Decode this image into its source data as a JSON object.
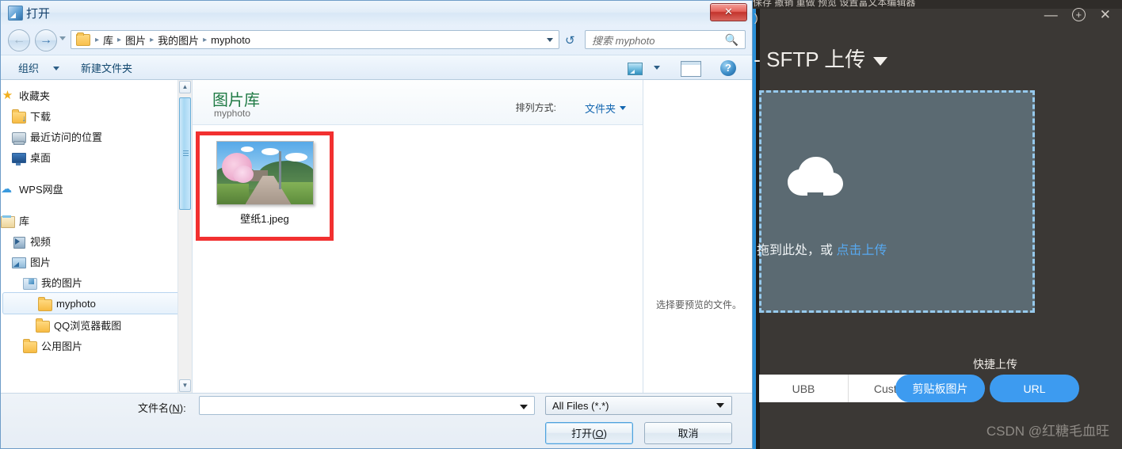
{
  "dialog": {
    "title": "打开",
    "title_icon": "picture-app-icon",
    "close_label": "✕",
    "nav": {
      "back_icon": "arrow-left-icon",
      "forward_icon": "arrow-right-icon",
      "history_icon": "chevron-down-icon",
      "folder_icon": "folder-icon",
      "breadcrumbs": [
        "库",
        "图片",
        "我的图片",
        "myphoto"
      ],
      "separator": "▸",
      "address_caret_icon": "chevron-down-icon",
      "refresh_icon": "refresh-icon"
    },
    "search": {
      "placeholder": "搜索 myphoto",
      "icon": "search-icon"
    },
    "toolbar": {
      "organize": "组织",
      "organize_caret_icon": "chevron-down-icon",
      "new_folder": "新建文件夹",
      "view_icon": "view-mode-icon",
      "view_caret_icon": "chevron-down-icon",
      "preview_pane_icon": "preview-pane-icon",
      "help_icon": "?"
    },
    "sidebar": {
      "items": [
        {
          "label": "收藏夹",
          "icon": "star-icon",
          "indent": 0,
          "selected": false
        },
        {
          "label": "下载",
          "icon": "download-folder-icon",
          "indent": 1,
          "selected": false
        },
        {
          "label": "最近访问的位置",
          "icon": "recent-places-icon",
          "indent": 1,
          "selected": false
        },
        {
          "label": "桌面",
          "icon": "desktop-icon",
          "indent": 1,
          "selected": false
        },
        {
          "label": "WPS网盘",
          "icon": "cloud-icon",
          "indent": 0,
          "selected": false
        },
        {
          "label": "库",
          "icon": "library-icon",
          "indent": 0,
          "selected": false
        },
        {
          "label": "视频",
          "icon": "video-library-icon",
          "indent": 1,
          "selected": false
        },
        {
          "label": "图片",
          "icon": "pictures-library-icon",
          "indent": 1,
          "selected": false
        },
        {
          "label": "我的图片",
          "icon": "my-pictures-icon",
          "indent": 2,
          "selected": false
        },
        {
          "label": "myphoto",
          "icon": "folder-icon",
          "indent": 3,
          "selected": true
        },
        {
          "label": "QQ浏览器截图",
          "icon": "folder-icon",
          "indent": 3,
          "selected": false
        },
        {
          "label": "公用图片",
          "icon": "folder-icon",
          "indent": 2,
          "selected": false
        }
      ],
      "scrollbar": {
        "up_arrow_icon": "▲",
        "down_arrow_icon": "▼"
      }
    },
    "library": {
      "title": "图片库",
      "subtitle": "myphoto",
      "arrange_label": "排列方式:",
      "arrange_value": "文件夹",
      "arrange_caret_icon": "chevron-down-icon",
      "title_color": "#1f7a44"
    },
    "files": [
      {
        "name": "壁纸1.jpeg",
        "thumbnail": "anime-landscape-cherry-blossom-road",
        "highlighted": true
      }
    ],
    "highlight_color": "#f23030",
    "preview": {
      "empty_text": "选择要预览的文件。"
    },
    "footer": {
      "filename_label_prefix": "文件名(",
      "filename_label_accel": "N",
      "filename_label_suffix": "):",
      "filename_value": "",
      "filename_caret_icon": "chevron-down-icon",
      "filter_value": "All Files (*.*)",
      "filter_caret_icon": "chevron-down-icon",
      "open_prefix": "打开(",
      "open_accel": "O",
      "open_suffix": ")",
      "cancel_label": "取消"
    }
  },
  "uploader": {
    "menustrip_text": "保存    撤销    重做            预览    设置富文本编辑器",
    "window_controls": {
      "minimize_icon": "—",
      "maximize_icon": "+",
      "close_icon": "✕"
    },
    "paren_fragment": ")",
    "heading": "传 - SFTP 上传",
    "heading_caret_icon": "chevron-down-icon",
    "dropzone": {
      "cloud_icon": "cloud-upload-icon",
      "text": "拖到此处，或",
      "link": "点击上传"
    },
    "quick_upload_label": "快捷上传",
    "segmented": [
      {
        "label": "UBB"
      },
      {
        "label": "Custom"
      }
    ],
    "pills": [
      {
        "label": "剪贴板图片"
      },
      {
        "label": "URL"
      }
    ],
    "accent_color": "#3d9bf0",
    "watermark": "CSDN @红糖毛血旺"
  }
}
